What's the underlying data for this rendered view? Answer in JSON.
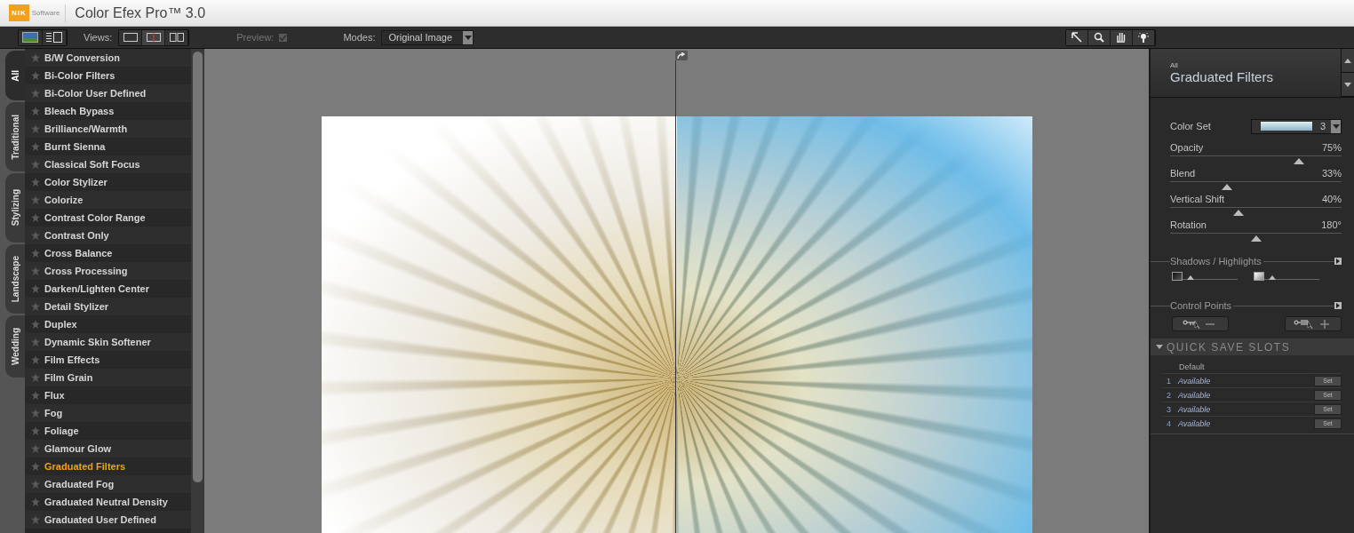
{
  "window": {
    "title": "Color Efex Pro™ 3.0",
    "logo_text": "NIK",
    "logo_subtext": "Software"
  },
  "toolbar": {
    "views_label": "Views:",
    "views": [
      {
        "kind": "single",
        "selected": false
      },
      {
        "kind": "split",
        "selected": true
      },
      {
        "kind": "side",
        "selected": false
      }
    ],
    "preview_label": "Preview:",
    "preview_checked": true,
    "preview_disabled": true,
    "modes_label": "Modes:",
    "mode_value": "Original Image"
  },
  "category_tabs": [
    {
      "label": "All",
      "selected": true
    },
    {
      "label": "Traditional",
      "selected": false
    },
    {
      "label": "Stylizing",
      "selected": false
    },
    {
      "label": "Landscape",
      "selected": false
    },
    {
      "label": "Wedding",
      "selected": false
    }
  ],
  "filters": [
    {
      "label": "B/W Conversion",
      "selected": false
    },
    {
      "label": "Bi-Color Filters",
      "selected": false
    },
    {
      "label": "Bi-Color User Defined",
      "selected": false
    },
    {
      "label": "Bleach Bypass",
      "selected": false
    },
    {
      "label": "Brilliance/Warmth",
      "selected": false
    },
    {
      "label": "Burnt Sienna",
      "selected": false
    },
    {
      "label": "Classical Soft Focus",
      "selected": false
    },
    {
      "label": "Color Stylizer",
      "selected": false
    },
    {
      "label": "Colorize",
      "selected": false
    },
    {
      "label": "Contrast Color Range",
      "selected": false
    },
    {
      "label": "Contrast Only",
      "selected": false
    },
    {
      "label": "Cross Balance",
      "selected": false
    },
    {
      "label": "Cross Processing",
      "selected": false
    },
    {
      "label": "Darken/Lighten Center",
      "selected": false
    },
    {
      "label": "Detail Stylizer",
      "selected": false
    },
    {
      "label": "Duplex",
      "selected": false
    },
    {
      "label": "Dynamic Skin Softener",
      "selected": false
    },
    {
      "label": "Film Effects",
      "selected": false
    },
    {
      "label": "Film Grain",
      "selected": false
    },
    {
      "label": "Flux",
      "selected": false
    },
    {
      "label": "Fog",
      "selected": false
    },
    {
      "label": "Foliage",
      "selected": false
    },
    {
      "label": "Glamour Glow",
      "selected": false
    },
    {
      "label": "Graduated Filters",
      "selected": true
    },
    {
      "label": "Graduated Fog",
      "selected": false
    },
    {
      "label": "Graduated Neutral Density",
      "selected": false
    },
    {
      "label": "Graduated User Defined",
      "selected": false
    }
  ],
  "panel": {
    "category": "All",
    "title": "Graduated Filters",
    "color_set_label": "Color Set",
    "color_set_value": "3",
    "sliders": [
      {
        "label": "Opacity",
        "reading": "75%",
        "level": 0.75
      },
      {
        "label": "Blend",
        "reading": "33%",
        "level": 0.33
      },
      {
        "label": "Vertical Shift",
        "reading": "40%",
        "level": 0.4
      },
      {
        "label": "Rotation",
        "reading": "180°",
        "level": 0.5
      }
    ],
    "shadows_highlights_label": "Shadows / Highlights",
    "tone_sliders": [
      {
        "kind": "shadows",
        "level": 0.08
      },
      {
        "kind": "highlights",
        "level": 0.08
      }
    ],
    "control_points_label": "Control Points",
    "quick_save": {
      "title": "QUICK SAVE SLOTS",
      "default_label": "Default",
      "slots": [
        {
          "number": "1",
          "label": "Available",
          "button": "Set"
        },
        {
          "number": "2",
          "label": "Available",
          "button": "Set"
        },
        {
          "number": "3",
          "label": "Available",
          "button": "Set"
        },
        {
          "number": "4",
          "label": "Available",
          "button": "Set"
        }
      ]
    }
  }
}
